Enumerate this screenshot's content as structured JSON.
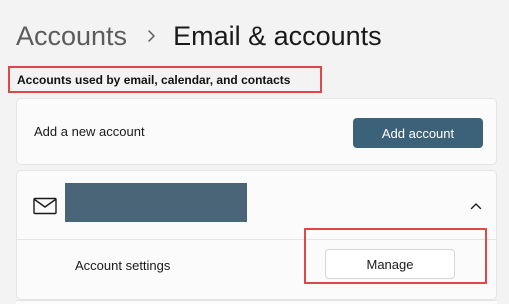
{
  "breadcrumb": {
    "parent": "Accounts",
    "separator_icon": "chevron-right-icon",
    "current": "Email & accounts"
  },
  "section": {
    "title": "Accounts used by email, calendar, and contacts"
  },
  "add_account_row": {
    "label": "Add a new account",
    "button_label": "Add account"
  },
  "account_card": {
    "icon": "mail-icon",
    "email_redacted": true,
    "expand_icon": "chevron-up-icon",
    "settings_label": "Account settings",
    "manage_button_label": "Manage"
  },
  "colors": {
    "background": "#f3f3f3",
    "card": "#fbfbfb",
    "accent_button": "#3c6279",
    "highlight_border": "#e04848",
    "redaction": "#4a6578"
  }
}
